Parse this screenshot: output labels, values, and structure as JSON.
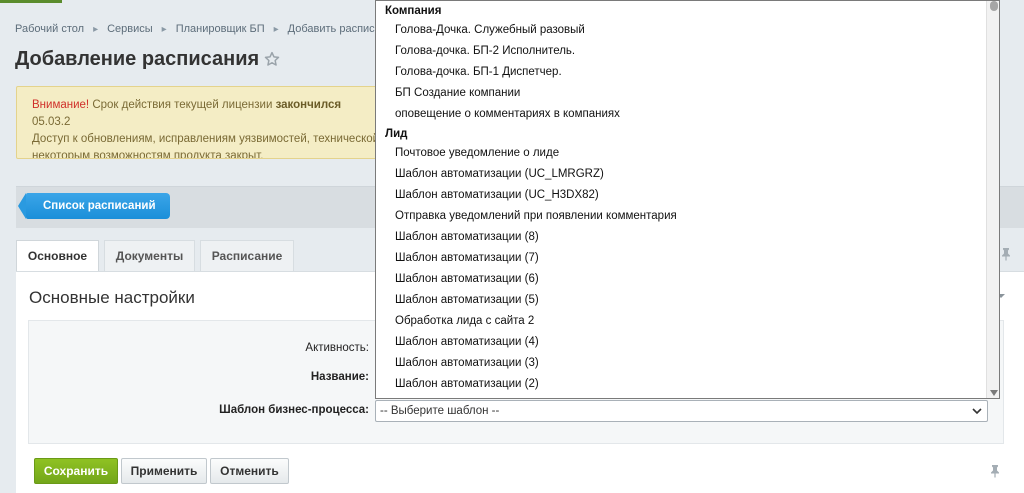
{
  "breadcrumb": {
    "items": [
      "Рабочий стол",
      "Сервисы",
      "Планировщик БП",
      "Добавить расписание"
    ]
  },
  "page": {
    "title": "Добавление расписания"
  },
  "alert": {
    "warning_label": "Внимание!",
    "text_1": " Срок действия текущей лицензии ",
    "text_bold": "закончился",
    "text_2": " 05.03.2",
    "line_2": "Доступ к обновлениям, исправлениям уязвимостей, технической",
    "line_3": "некоторым возможностям продукта закрыт."
  },
  "toolbar": {
    "list_button": "Список расписаний"
  },
  "tabs": [
    {
      "label": "Основное",
      "active": true
    },
    {
      "label": "Документы",
      "active": false
    },
    {
      "label": "Расписание",
      "active": false
    }
  ],
  "section": {
    "title": "Основные настройки"
  },
  "form": {
    "activity_label": "Активность:",
    "name_label": "Название:",
    "template_label": "Шаблон бизнес-процесса:",
    "template_value": "-- Выберите шаблон --"
  },
  "buttons": {
    "save": "Сохранить",
    "apply": "Применить",
    "cancel": "Отменить"
  },
  "dropdown": {
    "group_company": "Компания",
    "company_options": [
      "Голова-Дочка. Служебный разовый",
      "Голова-дочка. БП-2 Исполнитель.",
      "Голова-дочка. БП-1 Диспетчер.",
      "БП Создание компании",
      "оповещение о комментариях в компаниях"
    ],
    "group_lead": "Лид",
    "lead_options": [
      "Почтовое уведомление о лиде",
      "Шаблон автоматизации (UC_LMRGRZ)",
      "Шаблон автоматизации (UC_H3DX82)",
      "Отправка уведомлений при появлении комментария",
      "Шаблон автоматизации (8)",
      "Шаблон автоматизации (7)",
      "Шаблон автоматизации (6)",
      "Шаблон автоматизации (5)",
      "Обработка лида с сайта 2",
      "Шаблон автоматизации (4)",
      "Шаблон автоматизации (3)",
      "Шаблон автоматизации (2)"
    ]
  },
  "colors": {
    "accent_blue": "#1b8fd9",
    "save_green": "#7fb41f",
    "warning_red": "#d0302a",
    "alert_bg": "#f4edc5"
  },
  "icons": [
    "star-icon",
    "pin-icon",
    "chevron-down-icon",
    "collapse-icon"
  ]
}
